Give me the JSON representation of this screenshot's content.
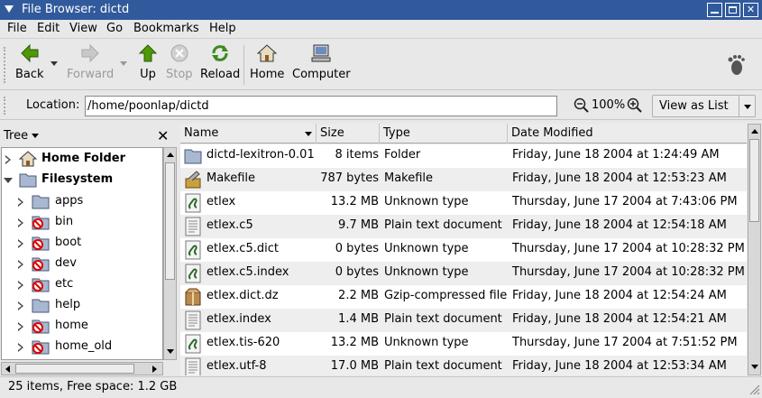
{
  "window": {
    "title": "File Browser: dictd"
  },
  "menu": [
    "File",
    "Edit",
    "View",
    "Go",
    "Bookmarks",
    "Help"
  ],
  "toolbar": {
    "back": "Back",
    "forward": "Forward",
    "up": "Up",
    "stop": "Stop",
    "reload": "Reload",
    "home": "Home",
    "computer": "Computer"
  },
  "location": {
    "label": "Location:",
    "value": "/home/poonlap/dictd",
    "zoom": "100%",
    "view": "View as List"
  },
  "side": {
    "title": "Tree",
    "nodes": [
      "Home Folder",
      "Filesystem",
      "apps",
      "bin",
      "boot",
      "dev",
      "etc",
      "help",
      "home",
      "home_old"
    ]
  },
  "columns": {
    "name": "Name",
    "size": "Size",
    "type": "Type",
    "date": "Date Modified"
  },
  "files": [
    {
      "name": "dictd-lexitron-0.01",
      "size": "8 items",
      "type": "Folder",
      "date": "Friday, June 18 2004 at 1:24:49 AM",
      "icon": "folder-icon"
    },
    {
      "name": "Makefile",
      "size": "787 bytes",
      "type": "Makefile",
      "date": "Friday, June 18 2004 at 12:53:23 AM",
      "icon": "makefile-icon"
    },
    {
      "name": "etlex",
      "size": "13.2 MB",
      "type": "Unknown type",
      "date": "Thursday, June 17 2004 at 7:43:06 PM",
      "icon": "unknown-file-icon"
    },
    {
      "name": "etlex.c5",
      "size": "9.7 MB",
      "type": "Plain text document",
      "date": "Friday, June 18 2004 at 12:54:18 AM",
      "icon": "text-file-icon"
    },
    {
      "name": "etlex.c5.dict",
      "size": "0 bytes",
      "type": "Unknown type",
      "date": "Thursday, June 17 2004 at 10:28:32 PM",
      "icon": "unknown-file-icon"
    },
    {
      "name": "etlex.c5.index",
      "size": "0 bytes",
      "type": "Unknown type",
      "date": "Thursday, June 17 2004 at 10:28:32 PM",
      "icon": "unknown-file-icon"
    },
    {
      "name": "etlex.dict.dz",
      "size": "2.2 MB",
      "type": "Gzip-compressed file",
      "date": "Friday, June 18 2004 at 12:54:24 AM",
      "icon": "archive-icon"
    },
    {
      "name": "etlex.index",
      "size": "1.4 MB",
      "type": "Plain text document",
      "date": "Friday, June 18 2004 at 12:54:21 AM",
      "icon": "text-file-icon"
    },
    {
      "name": "etlex.tis-620",
      "size": "13.2 MB",
      "type": "Unknown type",
      "date": "Thursday, June 17 2004 at 7:51:52 PM",
      "icon": "unknown-file-icon"
    },
    {
      "name": "etlex.utf-8",
      "size": "17.0 MB",
      "type": "Plain text document",
      "date": "Friday, June 18 2004 at 12:53:34 AM",
      "icon": "text-file-icon"
    }
  ],
  "status": "25 items, Free space: 1.2 GB"
}
